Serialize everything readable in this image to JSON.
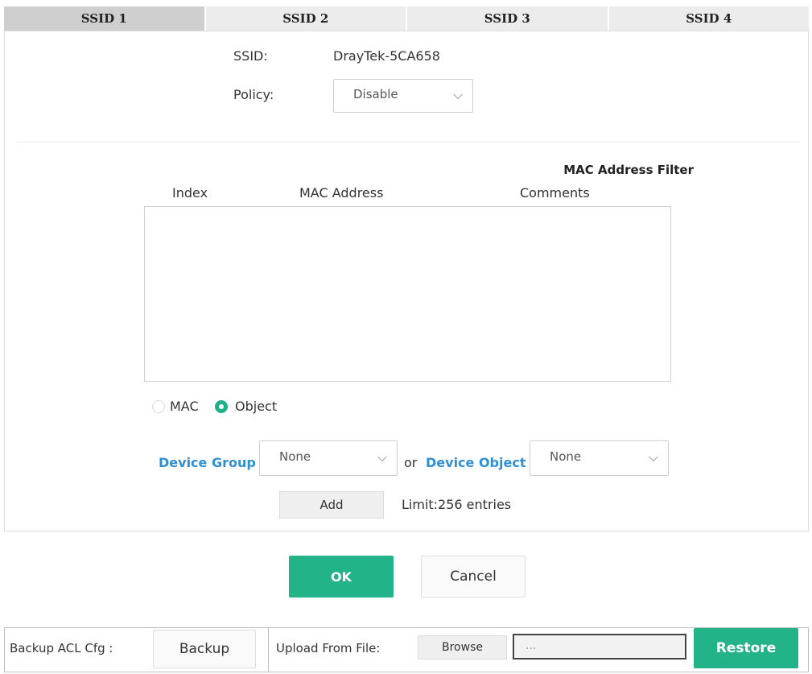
{
  "tabs": [
    "SSID 1",
    "SSID 2",
    "SSID 3",
    "SSID 4"
  ],
  "active_tab": 0,
  "ssid": {
    "label": "SSID:",
    "value": "DrayTek-5CA658"
  },
  "policy": {
    "label": "Policy:",
    "selected": "Disable"
  },
  "filter": {
    "title": "MAC Address Filter",
    "columns": [
      "Index",
      "MAC Address",
      "Comments"
    ],
    "entries": []
  },
  "mode": {
    "options": [
      "MAC",
      "Object"
    ],
    "selected": "Object"
  },
  "device_group": {
    "label": "Device Group",
    "selected": "None"
  },
  "or_text": "or",
  "device_object": {
    "label": "Device Object",
    "selected": "None"
  },
  "add_label": "Add",
  "limit_text": "Limit:256 entries",
  "ok_label": "OK",
  "cancel_label": "Cancel",
  "backup": {
    "label": "Backup ACL Cfg :",
    "button": "Backup"
  },
  "upload": {
    "label": "Upload From File:",
    "browse": "Browse",
    "file_placeholder": "...",
    "restore": "Restore"
  },
  "colors": {
    "accent": "#22b388",
    "link": "#2f8fd0",
    "tab_active": "#cfcfcf",
    "tab": "#ececec"
  }
}
